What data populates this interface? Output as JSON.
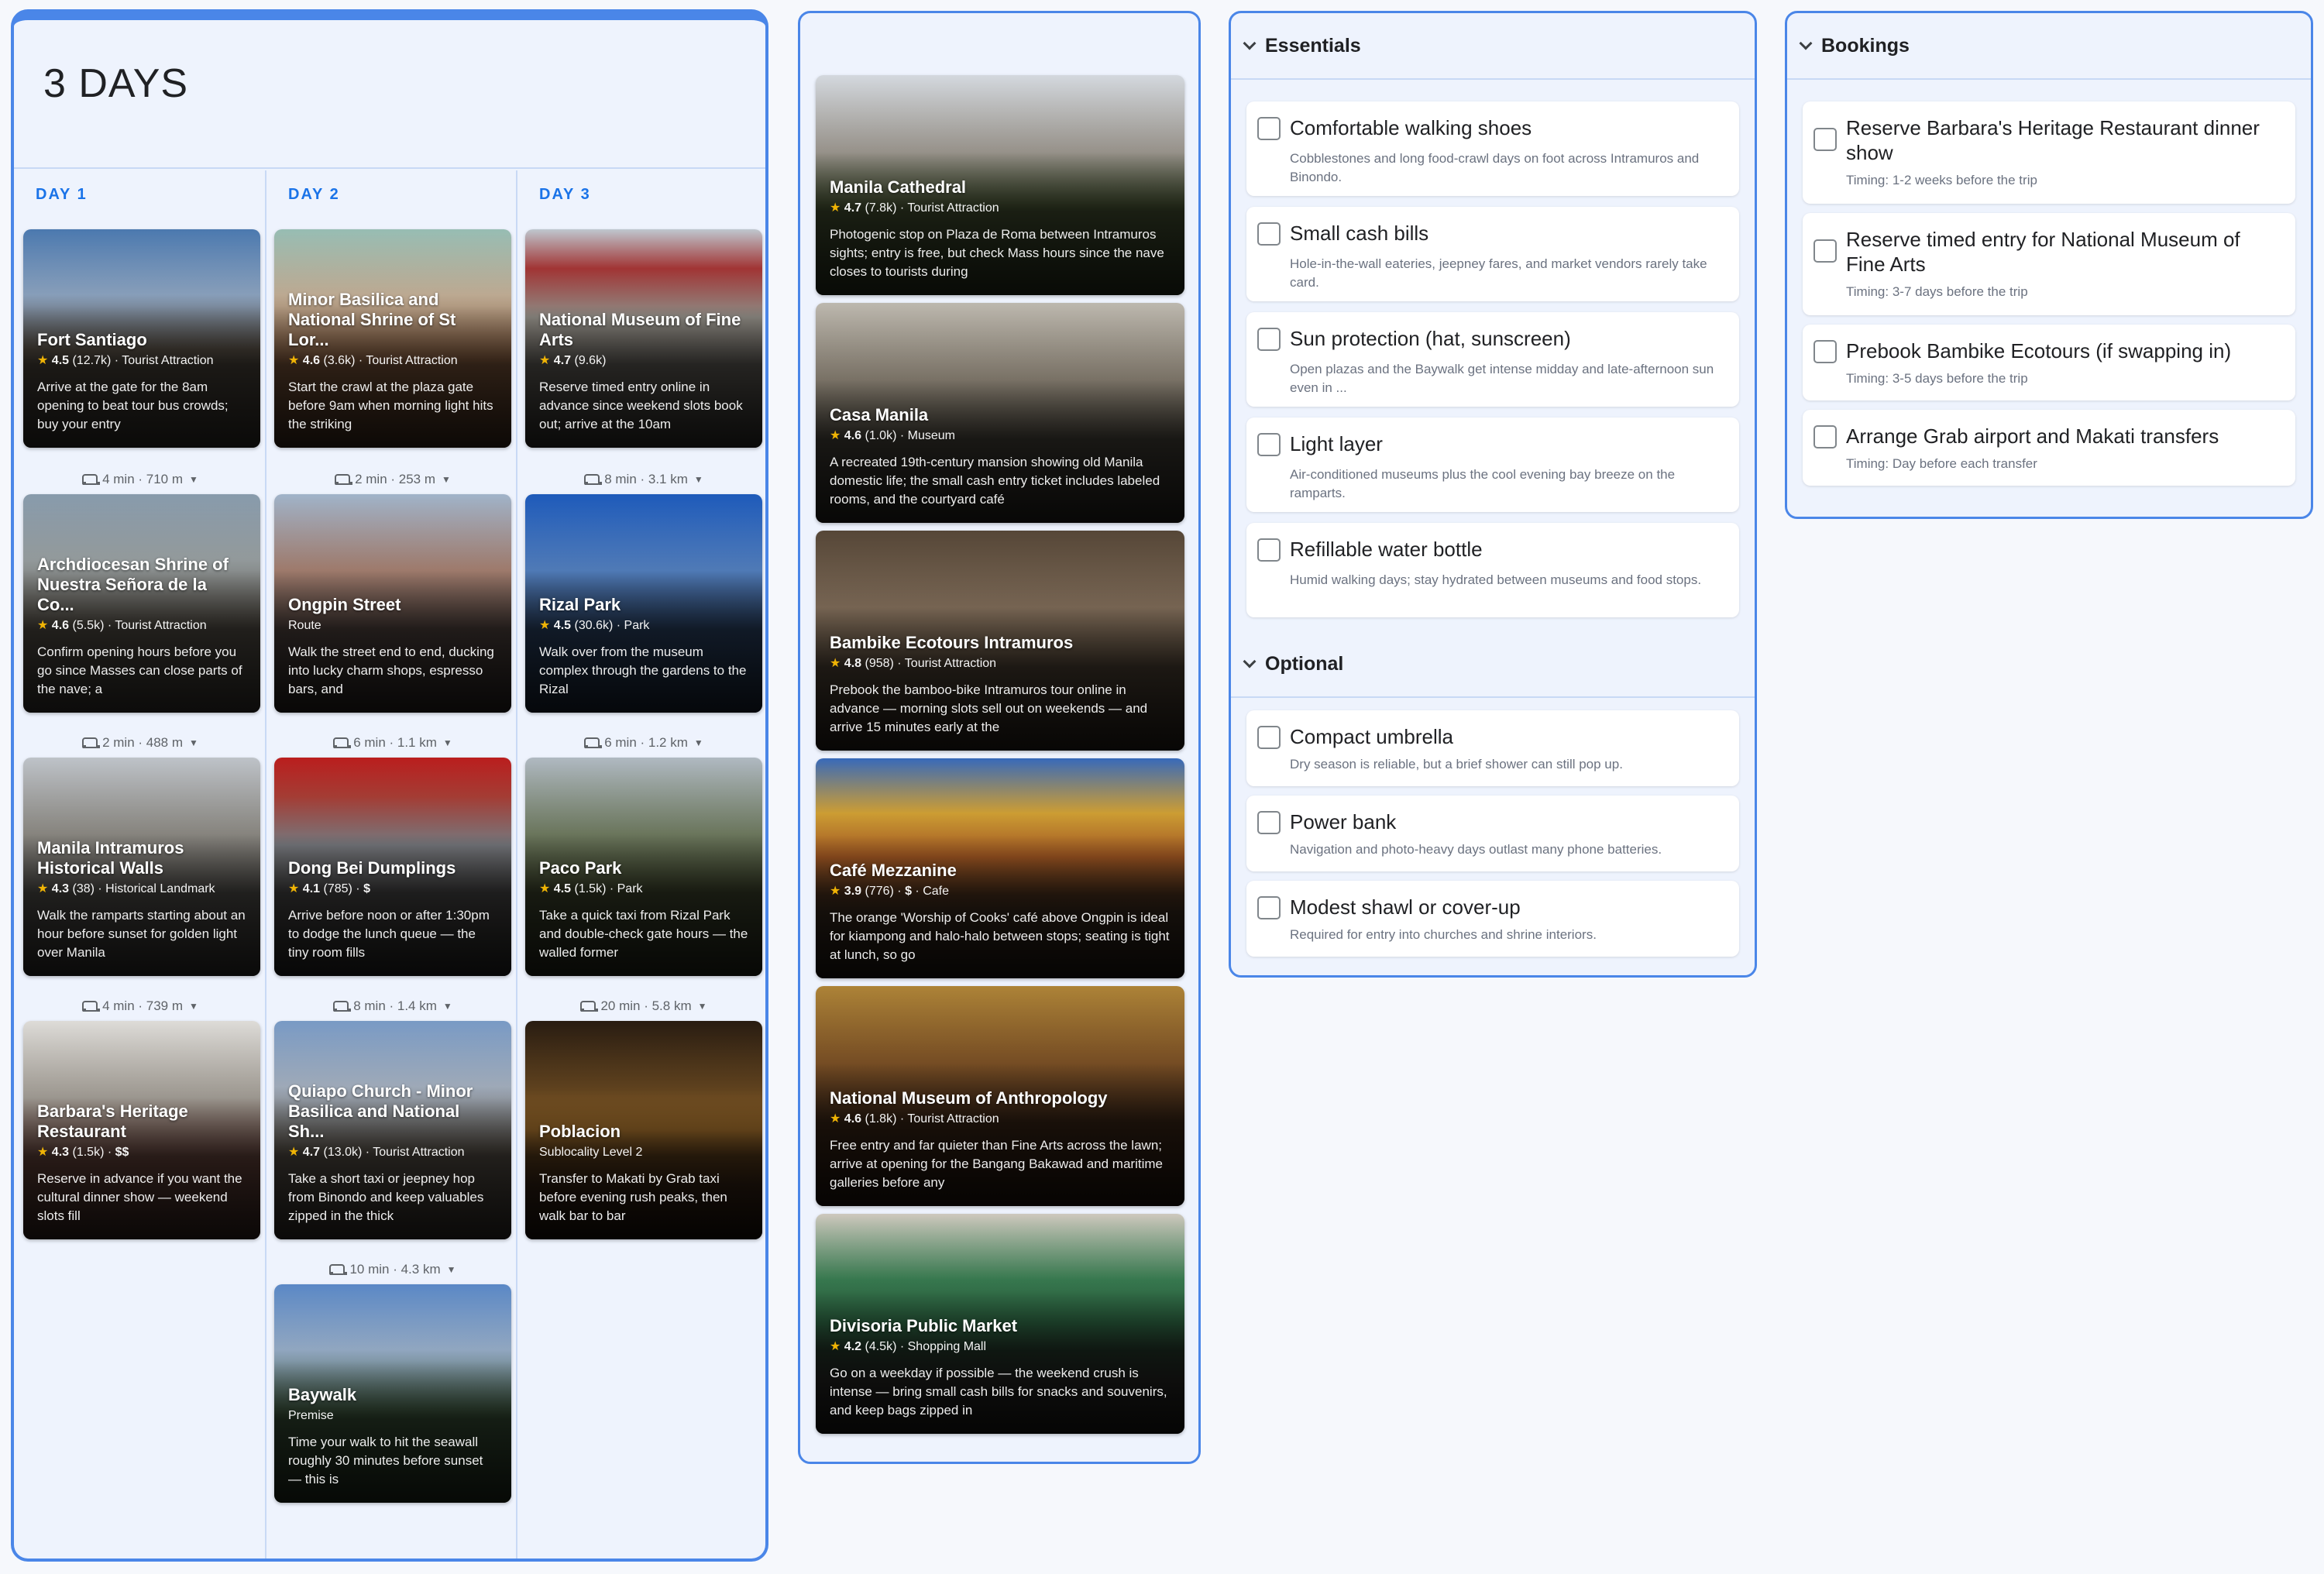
{
  "itinerary": {
    "title": "3 DAYS",
    "days": [
      {
        "label": "DAY 1",
        "stops": [
          {
            "name": "Fort Santiago",
            "rating": "4.5",
            "reviews": "(12.7k)",
            "category": "Tourist Attraction",
            "price": "",
            "desc": "Arrive at the gate for the 8am opening to beat tour bus crowds; buy your entry",
            "travel": "4 min · 710 m"
          },
          {
            "name": "Archdiocesan Shrine of Nuestra Señora de la Co...",
            "rating": "4.6",
            "reviews": "(5.5k)",
            "category": "Tourist Attraction",
            "price": "",
            "desc": "Confirm opening hours before you go since Masses can close parts of the nave; a",
            "travel": "2 min · 488 m"
          },
          {
            "name": "Manila Intramuros Historical Walls",
            "rating": "4.3",
            "reviews": "(38)",
            "category": "Historical Landmark",
            "price": "",
            "desc": "Walk the ramparts starting about an hour before sunset for golden light over Manila",
            "travel": "4 min · 739 m"
          },
          {
            "name": "Barbara's Heritage Restaurant",
            "rating": "4.3",
            "reviews": "(1.5k)",
            "category": "",
            "price": "$$",
            "desc": "Reserve in advance if you want the cultural dinner show — weekend slots fill",
            "travel": ""
          }
        ]
      },
      {
        "label": "DAY 2",
        "stops": [
          {
            "name": "Minor Basilica and National Shrine of St Lor...",
            "rating": "4.6",
            "reviews": "(3.6k)",
            "category": "Tourist Attraction",
            "price": "",
            "desc": "Start the crawl at the plaza gate before 9am when morning light hits the striking",
            "travel": "2 min · 253 m"
          },
          {
            "name": "Ongpin Street",
            "rating": "",
            "reviews": "",
            "category": "Route",
            "price": "",
            "desc": "Walk the street end to end, ducking into lucky charm shops, espresso bars, and",
            "travel": "6 min · 1.1 km"
          },
          {
            "name": "Dong Bei Dumplings",
            "rating": "4.1",
            "reviews": "(785)",
            "category": "",
            "price": "$",
            "desc": "Arrive before noon or after 1:30pm to dodge the lunch queue — the tiny room fills",
            "travel": "8 min · 1.4 km"
          },
          {
            "name": "Quiapo Church - Minor Basilica and National Sh...",
            "rating": "4.7",
            "reviews": "(13.0k)",
            "category": "Tourist Attraction",
            "price": "",
            "desc": "Take a short taxi or jeepney hop from Binondo and keep valuables zipped in the thick",
            "travel": "10 min · 4.3 km"
          },
          {
            "name": "Baywalk",
            "rating": "",
            "reviews": "",
            "category": "Premise",
            "price": "",
            "desc": "Time your walk to hit the seawall roughly 30 minutes before sunset — this is",
            "travel": ""
          }
        ]
      },
      {
        "label": "DAY 3",
        "stops": [
          {
            "name": "National Museum of Fine Arts",
            "rating": "4.7",
            "reviews": "(9.6k)",
            "category": "",
            "price": "",
            "desc": "Reserve timed entry online in advance since weekend slots book out; arrive at the 10am",
            "travel": "8 min · 3.1 km"
          },
          {
            "name": "Rizal Park",
            "rating": "4.5",
            "reviews": "(30.6k)",
            "category": "Park",
            "price": "",
            "desc": "Walk over from the museum complex through the gardens to the Rizal",
            "travel": "6 min · 1.2 km"
          },
          {
            "name": "Paco Park",
            "rating": "4.5",
            "reviews": "(1.5k)",
            "category": "Park",
            "price": "",
            "desc": "Take a quick taxi from Rizal Park and double-check gate hours — the walled former",
            "travel": "20 min · 5.8 km"
          },
          {
            "name": "Poblacion",
            "rating": "",
            "reviews": "",
            "category": "Sublocality Level 2",
            "price": "",
            "desc": "Transfer to Makati by Grab taxi before evening rush peaks, then walk bar to bar",
            "travel": ""
          }
        ]
      }
    ]
  },
  "ideas": [
    {
      "name": "Manila Cathedral",
      "rating": "4.7",
      "reviews": "(7.8k)",
      "category": "Tourist Attraction",
      "price": "",
      "desc": "Photogenic stop on Plaza de Roma between Intramuros sights; entry is free, but check Mass hours since the nave closes to tourists during"
    },
    {
      "name": "Casa Manila",
      "rating": "4.6",
      "reviews": "(1.0k)",
      "category": "Museum",
      "price": "",
      "desc": "A recreated 19th-century mansion showing old Manila domestic life; the small cash entry ticket includes labeled rooms, and the courtyard café"
    },
    {
      "name": "Bambike Ecotours Intramuros",
      "rating": "4.8",
      "reviews": "(958)",
      "category": "Tourist Attraction",
      "price": "",
      "desc": "Prebook the bamboo-bike Intramuros tour online in advance — morning slots sell out on weekends — and arrive 15 minutes early at the"
    },
    {
      "name": "Café Mezzanine",
      "rating": "3.9",
      "reviews": "(776)",
      "category": "Cafe",
      "price": "$",
      "desc": "The orange 'Worship of Cooks' café above Ongpin is ideal for kiampong and halo-halo between stops; seating is tight at lunch, so go"
    },
    {
      "name": "National Museum of Anthropology",
      "rating": "4.6",
      "reviews": "(1.8k)",
      "category": "Tourist Attraction",
      "price": "",
      "desc": "Free entry and far quieter than Fine Arts across the lawn; arrive at opening for the Bangang Bakawad and maritime galleries before any"
    },
    {
      "name": "Divisoria Public Market",
      "rating": "4.2",
      "reviews": "(4.5k)",
      "category": "Shopping Mall",
      "price": "",
      "desc": "Go on a weekday if possible — the weekend crush is intense — bring small cash bills for snacks and souvenirs, and keep bags zipped in"
    }
  ],
  "packing": {
    "sections": [
      {
        "title": "Essentials",
        "items": [
          {
            "title": "Comfortable walking shoes",
            "note": "Cobblestones and long food-crawl days on foot across Intramuros and Binondo."
          },
          {
            "title": "Small cash bills",
            "note": "Hole-in-the-wall eateries, jeepney fares, and market vendors rarely take card."
          },
          {
            "title": "Sun protection (hat, sunscreen)",
            "note": "Open plazas and the Baywalk get intense midday and late-afternoon sun even in ..."
          },
          {
            "title": "Light layer",
            "note": "Air-conditioned museums plus the cool evening bay breeze on the ramparts."
          },
          {
            "title": "Refillable water bottle",
            "note": "Humid walking days; stay hydrated between museums and food stops."
          }
        ]
      },
      {
        "title": "Optional",
        "items": [
          {
            "title": "Compact umbrella",
            "note": "Dry season is reliable, but a brief shower can still pop up."
          },
          {
            "title": "Power bank",
            "note": "Navigation and photo-heavy days outlast many phone batteries."
          },
          {
            "title": "Modest shawl or cover-up",
            "note": "Required for entry into churches and shrine interiors."
          }
        ]
      }
    ]
  },
  "bookings": {
    "title": "Bookings",
    "items": [
      {
        "title": "Reserve Barbara's Heritage Restaurant dinner show",
        "note": "Timing: 1-2 weeks before the trip"
      },
      {
        "title": "Reserve timed entry for National Museum of Fine Arts",
        "note": "Timing: 3-7 days before the trip"
      },
      {
        "title": "Prebook Bambike Ecotours (if swapping in)",
        "note": "Timing: 3-5 days before the trip"
      },
      {
        "title": "Arrange Grab airport and Makati transfers",
        "note": "Timing: Day before each transfer"
      }
    ]
  },
  "colors": {
    "accent": "#1a73e8",
    "panel_border": "#4a86e8",
    "panel_bg": "#eef3fd",
    "star": "#fbbc04"
  }
}
